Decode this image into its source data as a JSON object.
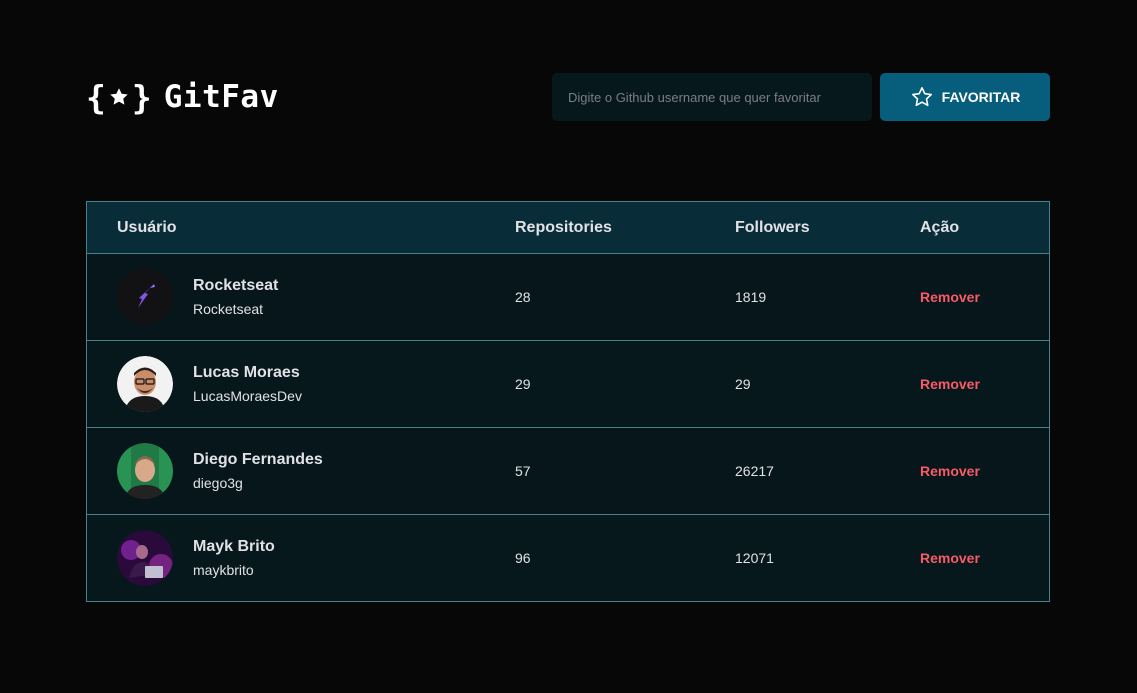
{
  "app": {
    "logo_text": "GitFav"
  },
  "search": {
    "placeholder": "Digite o Github username que quer favoritar",
    "button_label": "FAVORITAR"
  },
  "table": {
    "headers": {
      "user": "Usuário",
      "repositories": "Repositories",
      "followers": "Followers",
      "action": "Ação"
    },
    "rows": [
      {
        "name": "Rocketseat",
        "login": "Rocketseat",
        "repositories": "28",
        "followers": "1819",
        "action": "Remover"
      },
      {
        "name": "Lucas Moraes",
        "login": "LucasMoraesDev",
        "repositories": "29",
        "followers": "29",
        "action": "Remover"
      },
      {
        "name": "Diego Fernandes",
        "login": "diego3g",
        "repositories": "57",
        "followers": "26217",
        "action": "Remover"
      },
      {
        "name": "Mayk Brito",
        "login": "maykbrito",
        "repositories": "96",
        "followers": "12071",
        "action": "Remover"
      }
    ]
  },
  "colors": {
    "background": "#070707",
    "header_row": "#092d38",
    "accent_button": "#065e7c",
    "remove": "#f75a68",
    "border": "#4a808c"
  }
}
